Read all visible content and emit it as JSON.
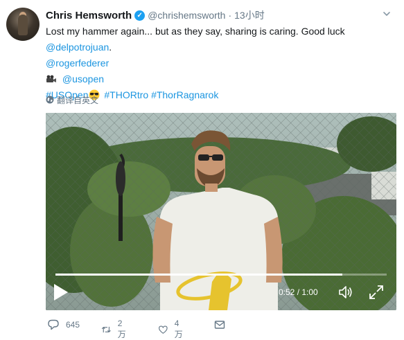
{
  "tweet": {
    "author_name": "Chris Hemsworth",
    "handle": "@chrishemsworth",
    "separator": "·",
    "time": "13小时",
    "line1": "Lost my hammer again... but as they say, sharing is caring. Good luck",
    "mention1": "@delpotrojuan",
    "mention1_suffix": ".",
    "mention2": "@rogerfederer",
    "mention3": "@usopen",
    "hashtag1": "#USOpen",
    "hashtag2": "#THORtro",
    "hashtag3": "#ThorRagnarok",
    "translate_label": "翻译自英文"
  },
  "video": {
    "current_time": "0:52",
    "time_sep": " / ",
    "duration": "1:00",
    "progress_fraction": 0.867
  },
  "actions": {
    "reply_count": "645",
    "retweet_count": "2万",
    "like_count": "4万"
  },
  "icons": {
    "verified": "verified-badge-icon",
    "caret": "chevron-down-icon",
    "camera": "movie-camera-emoji",
    "sunglasses": "sunglasses-emoji",
    "globe": "globe-icon",
    "play": "play-icon",
    "volume": "volume-icon",
    "fullscreen": "fullscreen-icon",
    "reply": "reply-icon",
    "retweet": "retweet-icon",
    "like": "heart-icon",
    "dm": "envelope-icon"
  },
  "colors": {
    "link": "#1b95e0",
    "verified": "#1da1f2",
    "muted": "#657786",
    "text": "#14171a"
  }
}
